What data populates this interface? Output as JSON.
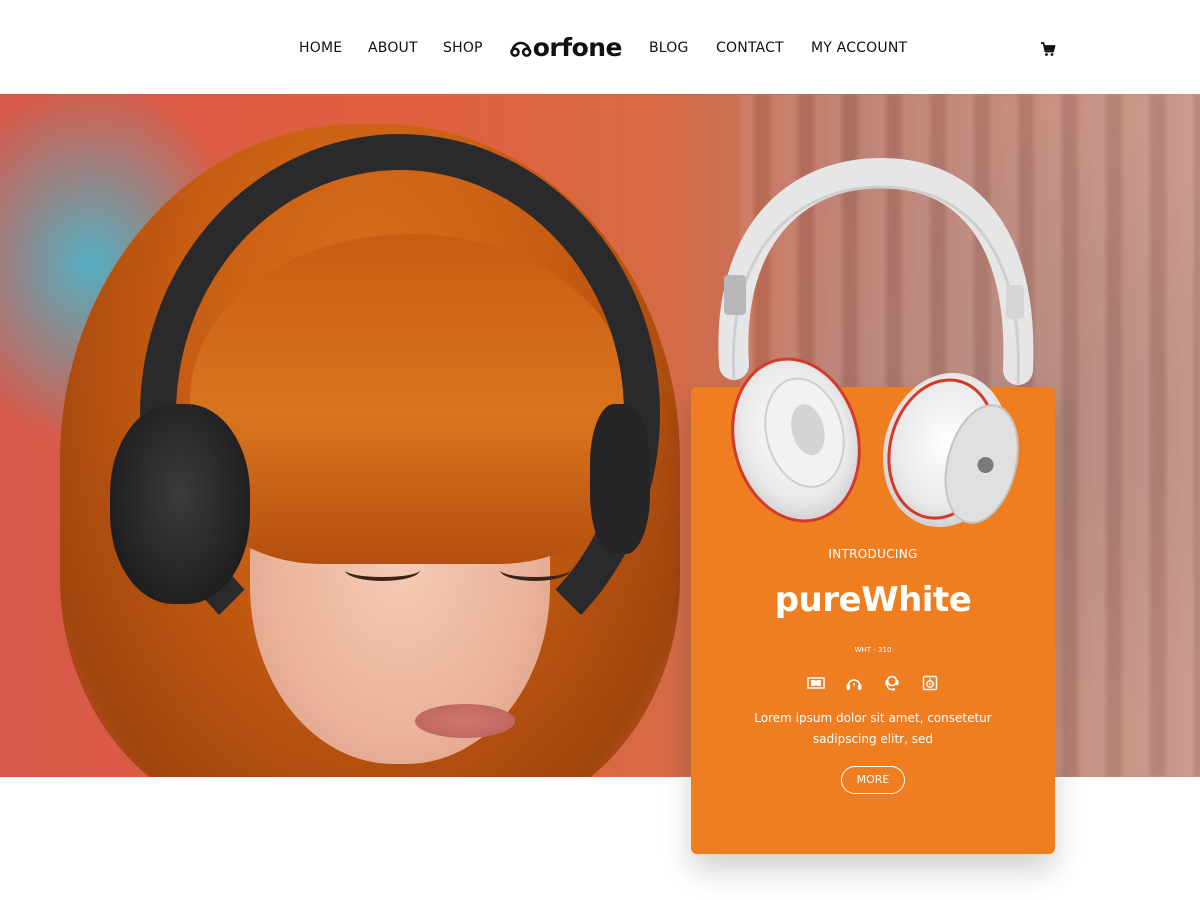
{
  "nav": {
    "left": [
      "HOME",
      "ABOUT",
      "SHOP"
    ],
    "right": [
      "BLOG",
      "CONTACT",
      "MY ACCOUNT"
    ],
    "logo_text": "orfone"
  },
  "hero": {
    "card": {
      "eyebrow": "INTRODUCING",
      "title": "pureWhite",
      "model": "WHT - 310",
      "description": "Lorem ipsum dolor sit amet, consetetur sadipscing elitr, sed",
      "button_label": "MORE",
      "feature_icons": [
        "dolby-icon",
        "headset-icon",
        "mic-headset-icon",
        "speaker-icon"
      ]
    }
  },
  "colors": {
    "accent": "#ee7e20",
    "text": "#111111",
    "background": "#ffffff"
  }
}
